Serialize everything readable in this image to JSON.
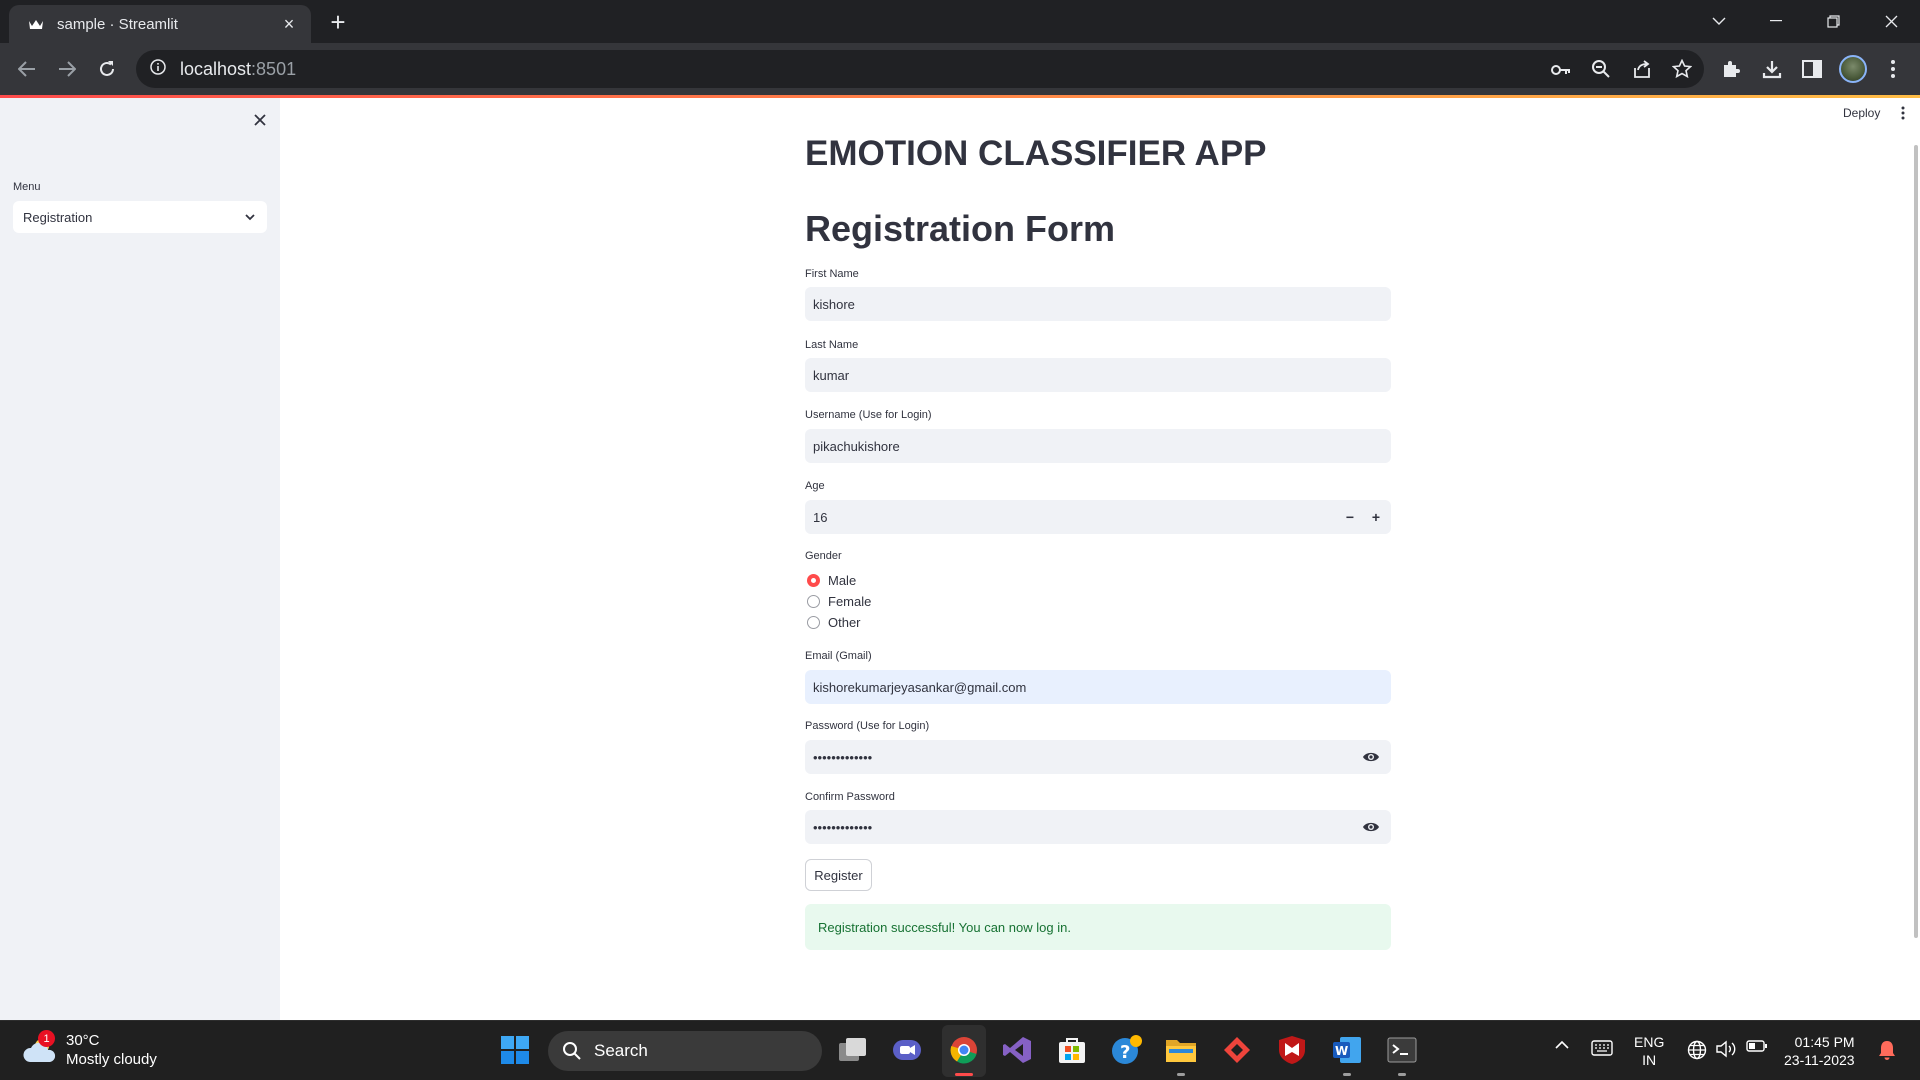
{
  "browser": {
    "tab_title": "sample · Streamlit",
    "url_host": "localhost",
    "url_port": ":8501"
  },
  "app": {
    "deploy_label": "Deploy",
    "sidebar": {
      "menu_label": "Menu",
      "menu_value": "Registration"
    },
    "title": "EMOTION CLASSIFIER APP",
    "form_title": "Registration Form",
    "fields": {
      "first_name": {
        "label": "First Name",
        "value": "kishore"
      },
      "last_name": {
        "label": "Last Name",
        "value": "kumar"
      },
      "username": {
        "label": "Username (Use for Login)",
        "value": "pikachukishore"
      },
      "age": {
        "label": "Age",
        "value": "16",
        "minus": "−",
        "plus": "+"
      },
      "gender": {
        "label": "Gender",
        "options": [
          "Male",
          "Female",
          "Other"
        ],
        "selected": "Male"
      },
      "email": {
        "label": "Email (Gmail)",
        "value": "kishorekumarjeyasankar@gmail.com"
      },
      "password": {
        "label": "Password (Use for Login)",
        "value": "•••••••••••••"
      },
      "confirm_password": {
        "label": "Confirm Password",
        "value": "•••••••••••••"
      }
    },
    "register_label": "Register",
    "success_message": "Registration successful! You can now log in.",
    "accent_color": "#ff4b4b",
    "success_color": "#177233"
  },
  "taskbar": {
    "weather_badge": "1",
    "temperature": "30°C",
    "condition": "Mostly cloudy",
    "search_label": "Search",
    "lang_top": "ENG",
    "lang_bottom": "IN",
    "time": "01:45 PM",
    "date": "23-11-2023"
  }
}
